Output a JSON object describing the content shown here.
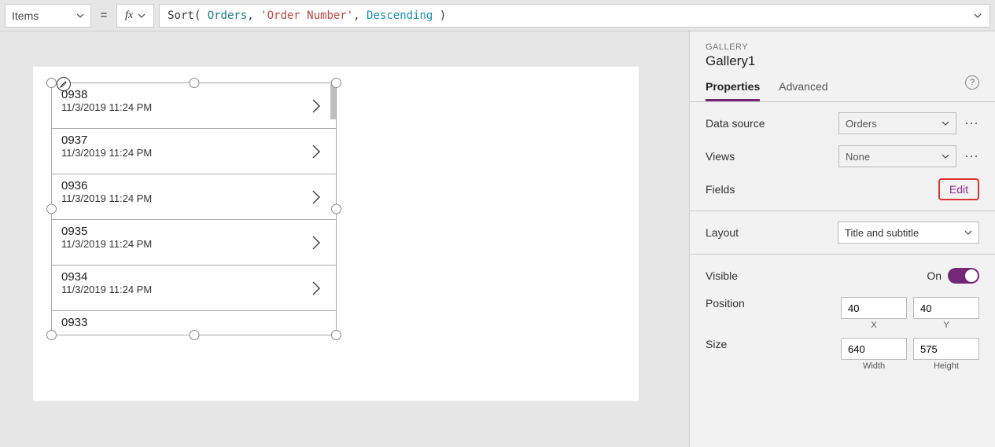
{
  "formulaBar": {
    "property": "Items",
    "equals": "=",
    "fx": "fx",
    "tokens": {
      "fn": "Sort",
      "p1": "(",
      "sp1": " ",
      "id": "Orders",
      "c1": ",",
      "sp2": " ",
      "str": "'Order Number'",
      "c2": ",",
      "sp3": " ",
      "kw": "Descending",
      "sp4": " ",
      "p2": ")"
    }
  },
  "gallery": {
    "rows": [
      {
        "title": "0938",
        "subtitle": "11/3/2019 11:24 PM"
      },
      {
        "title": "0937",
        "subtitle": "11/3/2019 11:24 PM"
      },
      {
        "title": "0936",
        "subtitle": "11/3/2019 11:24 PM"
      },
      {
        "title": "0935",
        "subtitle": "11/3/2019 11:24 PM"
      },
      {
        "title": "0934",
        "subtitle": "11/3/2019 11:24 PM"
      },
      {
        "title": "0933",
        "subtitle": ""
      }
    ]
  },
  "panel": {
    "type": "GALLERY",
    "name": "Gallery1",
    "tabs": {
      "properties": "Properties",
      "advanced": "Advanced"
    },
    "dataSource": {
      "label": "Data source",
      "value": "Orders"
    },
    "views": {
      "label": "Views",
      "value": "None"
    },
    "fields": {
      "label": "Fields",
      "edit": "Edit"
    },
    "layout": {
      "label": "Layout",
      "value": "Title and subtitle"
    },
    "visible": {
      "label": "Visible",
      "value": "On"
    },
    "position": {
      "label": "Position",
      "x": "40",
      "y": "40",
      "xcap": "X",
      "ycap": "Y"
    },
    "size": {
      "label": "Size",
      "w": "640",
      "h": "575",
      "wcap": "Width",
      "hcap": "Height"
    }
  }
}
